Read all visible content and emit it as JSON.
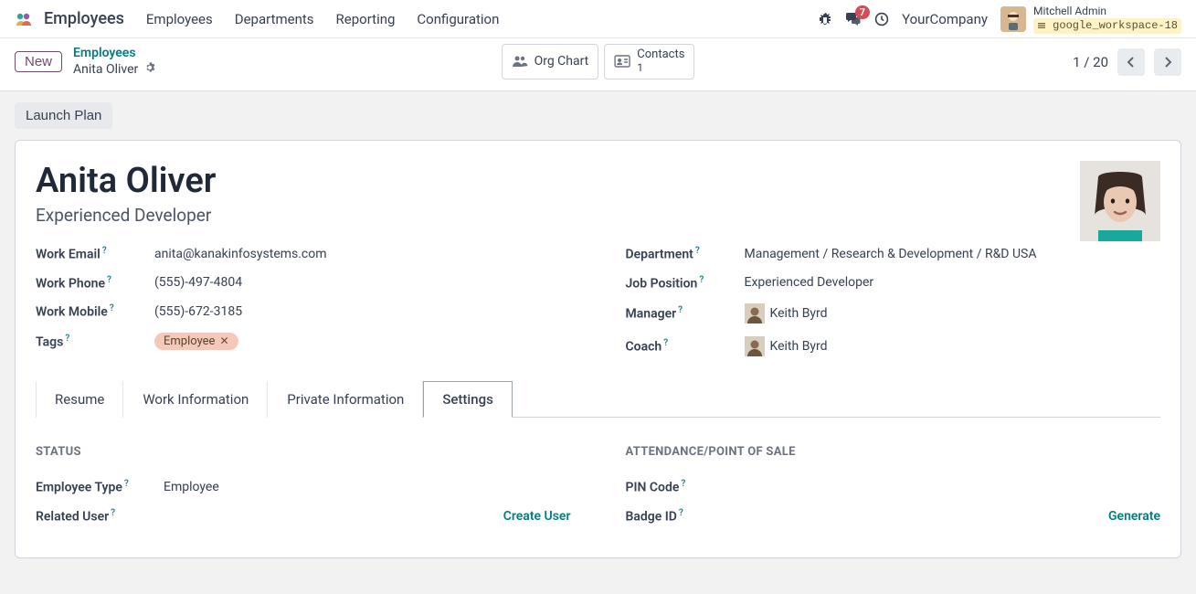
{
  "nav": {
    "app_title": "Employees",
    "menu": [
      "Employees",
      "Departments",
      "Reporting",
      "Configuration"
    ],
    "msg_count": "7",
    "company": "YourCompany",
    "user_name": "Mitchell Admin",
    "workspace": "google_workspace-18"
  },
  "controlbar": {
    "new_label": "New",
    "breadcrumb_parent": "Employees",
    "breadcrumb_current": "Anita Oliver",
    "stats": {
      "org_chart": "Org Chart",
      "contacts_label": "Contacts",
      "contacts_count": "1"
    },
    "pager": "1 / 20"
  },
  "card": {
    "launch_plan": "Launch Plan",
    "name": "Anita Oliver",
    "title": "Experienced Developer",
    "left": {
      "work_email_label": "Work Email",
      "work_email": "anita@kanakinfosystems.com",
      "work_phone_label": "Work Phone",
      "work_phone": "(555)-497-4804",
      "work_mobile_label": "Work Mobile",
      "work_mobile": "(555)-672-3185",
      "tags_label": "Tags",
      "tag": "Employee"
    },
    "right": {
      "department_label": "Department",
      "department": "Management / Research & Development / R&D USA",
      "job_position_label": "Job Position",
      "job_position": "Experienced Developer",
      "manager_label": "Manager",
      "manager": "Keith Byrd",
      "coach_label": "Coach",
      "coach": "Keith Byrd"
    },
    "tabs": [
      "Resume",
      "Work Information",
      "Private Information",
      "Settings"
    ],
    "active_tab": 3,
    "settings": {
      "status_heading": "STATUS",
      "employee_type_label": "Employee Type",
      "employee_type": "Employee",
      "related_user_label": "Related User",
      "create_user": "Create User",
      "attendance_heading": "ATTENDANCE/POINT OF SALE",
      "pin_label": "PIN Code",
      "badge_label": "Badge ID",
      "generate": "Generate"
    }
  }
}
